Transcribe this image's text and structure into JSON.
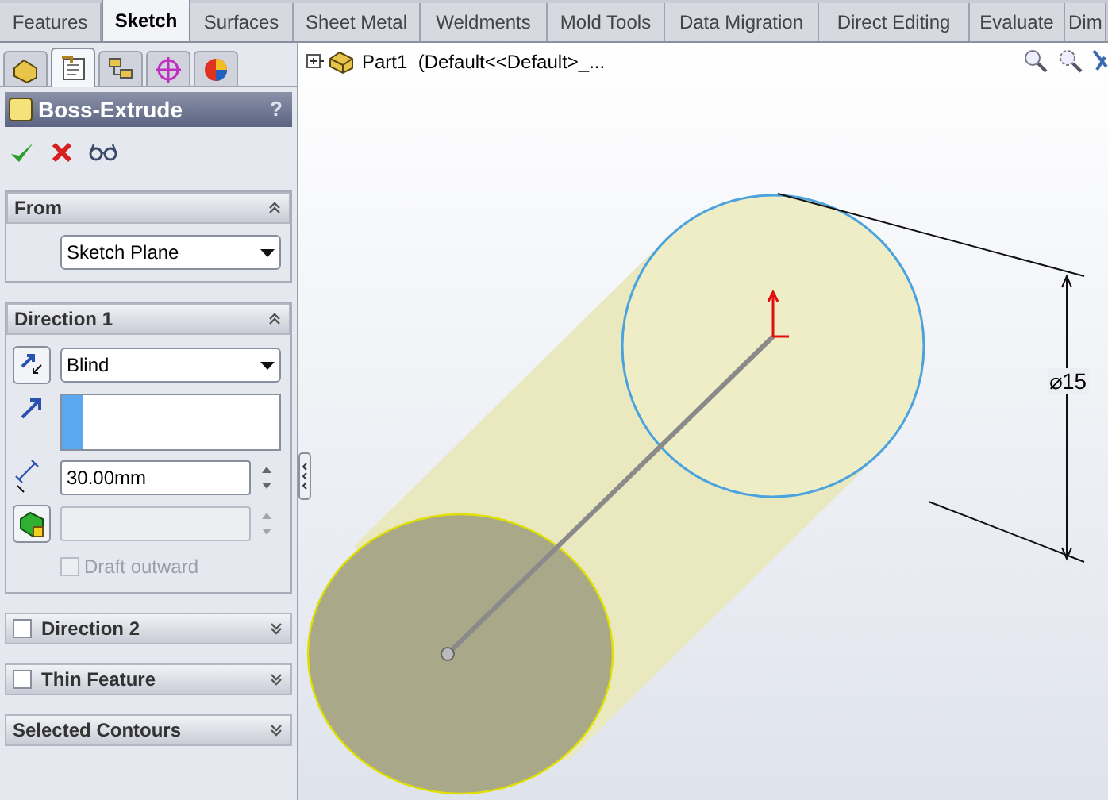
{
  "tabs": [
    {
      "label": "Features",
      "selected": false
    },
    {
      "label": "Sketch",
      "selected": true
    },
    {
      "label": "Surfaces",
      "selected": false
    },
    {
      "label": "Sheet Metal",
      "selected": false
    },
    {
      "label": "Weldments",
      "selected": false
    },
    {
      "label": "Mold Tools",
      "selected": false
    },
    {
      "label": "Data Migration",
      "selected": false
    },
    {
      "label": "Direct Editing",
      "selected": false
    },
    {
      "label": "Evaluate",
      "selected": false
    },
    {
      "label": "Dim",
      "selected": false
    }
  ],
  "panel_tabs": [
    {
      "selected": false
    },
    {
      "selected": true
    },
    {
      "selected": false
    },
    {
      "selected": false
    },
    {
      "selected": false
    }
  ],
  "property_manager": {
    "title": "Boss-Extrude",
    "help": "?",
    "sections": [
      {
        "title": "From",
        "expanded": true,
        "items": [
          {
            "kind": "dropdown",
            "value": "Sketch Plane"
          }
        ]
      },
      {
        "title": "Direction 1",
        "expanded": true,
        "items": [
          {
            "kind": "end_condition",
            "value": "Blind"
          },
          {
            "kind": "direction_box"
          },
          {
            "kind": "depth",
            "value": "30.00mm",
            "disabled": false
          },
          {
            "kind": "draft",
            "disabled": true
          },
          {
            "kind": "checkbox",
            "label": "Draft outward",
            "checked": false,
            "disabled": true
          }
        ]
      },
      {
        "title": "Direction 2",
        "expanded": false,
        "checked": false
      },
      {
        "title": "Thin Feature",
        "expanded": false,
        "checked": false
      },
      {
        "title": "Selected Contours",
        "expanded": false
      }
    ]
  },
  "tree": {
    "label": "Part1  (Default<<Default>_..."
  },
  "dimension": {
    "label": "⌀15"
  }
}
